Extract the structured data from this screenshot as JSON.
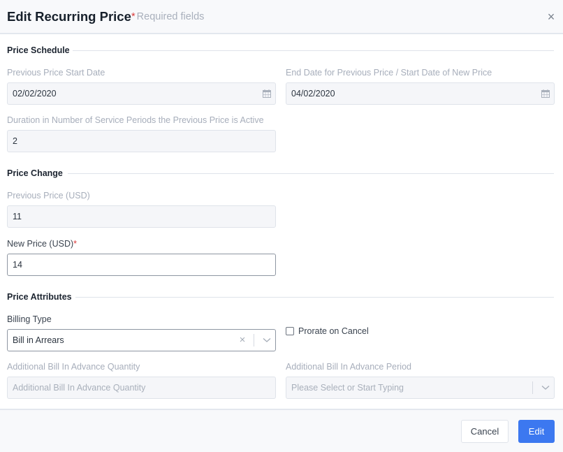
{
  "header": {
    "title": "Edit Recurring Price",
    "required_star": "*",
    "required_note": "Required fields",
    "close_icon": "×"
  },
  "sections": {
    "price_schedule": {
      "title": "Price Schedule",
      "previous_start_label": "Previous Price Start Date",
      "previous_start_value": "02/02/2020",
      "end_date_label": "End Date for Previous Price / Start Date of New Price",
      "end_date_value": "04/02/2020",
      "duration_label": "Duration in Number of Service Periods the Previous Price is Active",
      "duration_value": "2"
    },
    "price_change": {
      "title": "Price Change",
      "previous_price_label": "Previous Price (USD)",
      "previous_price_value": "11",
      "new_price_label": "New Price (USD)",
      "new_price_star": "*",
      "new_price_value": "14"
    },
    "price_attributes": {
      "title": "Price Attributes",
      "billing_type_label": "Billing Type",
      "billing_type_value": "Bill in Arrears",
      "clear_icon": "×",
      "prorate_label": "Prorate on Cancel",
      "prorate_checked": false,
      "advance_quantity_label": "Additional Bill In Advance Quantity",
      "advance_quantity_placeholder": "Additional Bill In Advance Quantity",
      "advance_period_label": "Additional Bill In Advance Period",
      "advance_period_placeholder": "Please Select or Start Typing"
    }
  },
  "footer": {
    "cancel_label": "Cancel",
    "edit_label": "Edit"
  },
  "colors": {
    "primary": "#3c78f0",
    "required": "#d93b3b"
  }
}
